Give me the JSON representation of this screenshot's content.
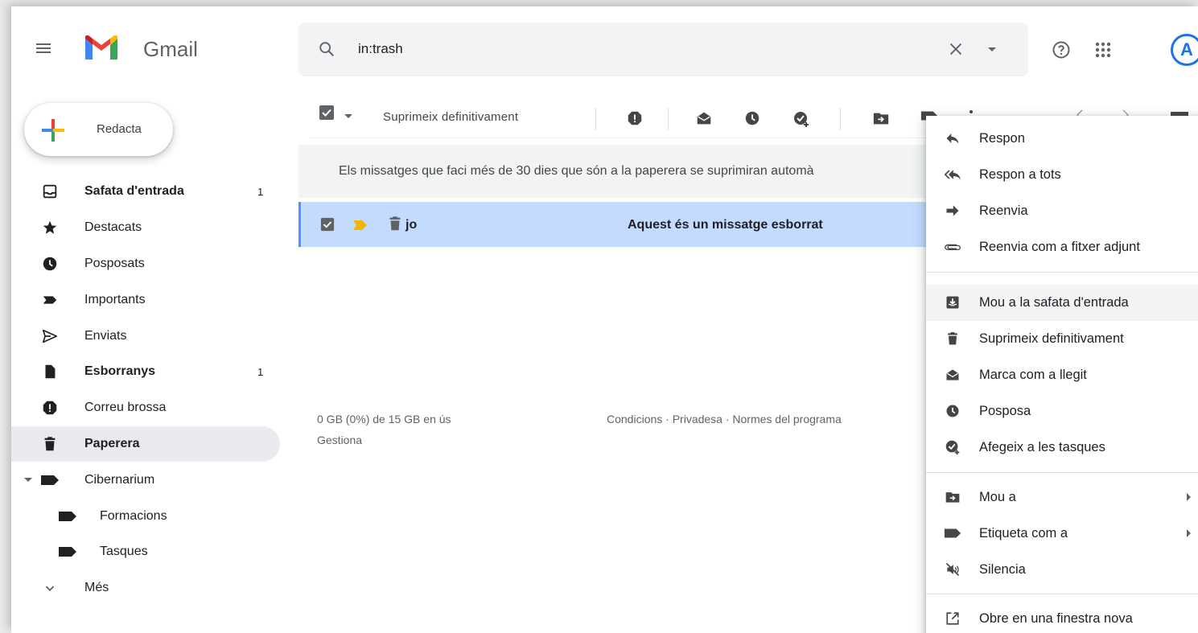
{
  "header": {
    "app_name": "Gmail",
    "search_value": "in:trash",
    "avatar_letter": "A"
  },
  "compose": {
    "label": "Redacta"
  },
  "sidebar": {
    "items": [
      {
        "label": "Safata d'entrada",
        "count": "1",
        "icon": "inbox-icon",
        "bold": true
      },
      {
        "label": "Destacats",
        "count": "",
        "icon": "star-icon"
      },
      {
        "label": "Posposats",
        "count": "",
        "icon": "clock-icon"
      },
      {
        "label": "Importants",
        "count": "",
        "icon": "important-icon"
      },
      {
        "label": "Enviats",
        "count": "",
        "icon": "send-icon"
      },
      {
        "label": "Esborranys",
        "count": "1",
        "icon": "draft-icon",
        "bold": true
      },
      {
        "label": "Correu brossa",
        "count": "",
        "icon": "spam-icon"
      },
      {
        "label": "Paperera",
        "count": "",
        "icon": "trash-icon",
        "bold": true,
        "active": true
      },
      {
        "label": "Cibernarium",
        "count": "",
        "icon": "label-icon"
      },
      {
        "label": "Formacions",
        "count": "",
        "icon": "label-icon",
        "sub": true
      },
      {
        "label": "Tasques",
        "count": "",
        "icon": "label-icon",
        "sub": true
      },
      {
        "label": "Més",
        "count": "",
        "icon": "chevron-down-icon"
      }
    ]
  },
  "toolbar": {
    "delete_forever_label": "Suprimeix definitivament"
  },
  "notice": {
    "text": "Els missatges que faci més de 30 dies que són a la paperera se suprimiran automà"
  },
  "messages": [
    {
      "sender": "jo",
      "subject": "Aquest és un missatge esborrat",
      "selected": true
    }
  ],
  "footer": {
    "usage": "0 GB (0%) de 15 GB en ús",
    "manage": "Gestiona",
    "links": "Condicions · Privadesa · Normes del programa"
  },
  "context_menu": {
    "items": [
      {
        "label": "Respon",
        "icon": "reply-icon"
      },
      {
        "label": "Respon a tots",
        "icon": "reply-all-icon"
      },
      {
        "label": "Reenvia",
        "icon": "forward-icon"
      },
      {
        "label": "Reenvia com a fitxer adjunt",
        "icon": "attachment-icon"
      },
      {
        "label": "Mou a la safata d'entrada",
        "icon": "move-to-inbox-icon",
        "highlighted": true
      },
      {
        "label": "Suprimeix definitivament",
        "icon": "trash-icon"
      },
      {
        "label": "Marca com a llegit",
        "icon": "mark-read-icon"
      },
      {
        "label": "Posposa",
        "icon": "clock-icon"
      },
      {
        "label": "Afegeix a les tasques",
        "icon": "add-task-icon"
      },
      {
        "label": "Mou a",
        "icon": "move-to-icon",
        "submenu": true
      },
      {
        "label": "Etiqueta com a",
        "icon": "label-icon",
        "submenu": true
      },
      {
        "label": "Silencia",
        "icon": "mute-icon"
      },
      {
        "label": "Obre en una finestra nova",
        "icon": "open-new-window-icon"
      }
    ]
  },
  "colors": {
    "selected_row": "#c2dbff",
    "active_nav": "#e8eaed",
    "important_marker": "#f2b600",
    "accent_blue": "#1a73e8"
  }
}
